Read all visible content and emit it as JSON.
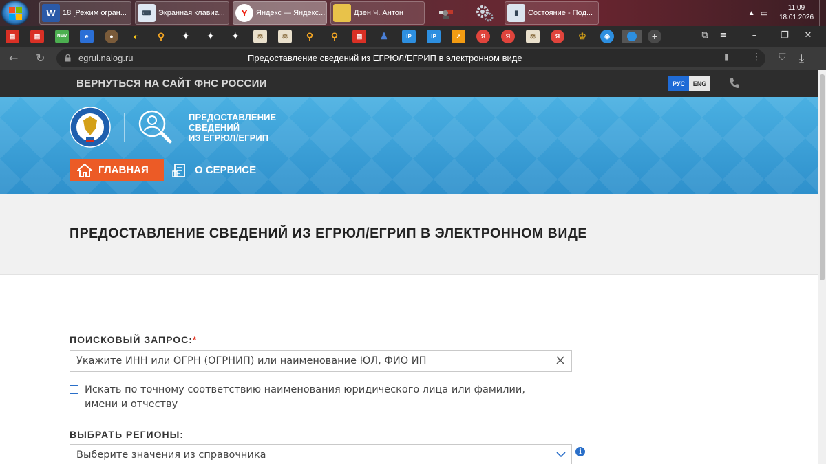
{
  "taskbar": {
    "items": [
      {
        "label": "18 [Режим огран...",
        "icon": "word-icon"
      },
      {
        "label": "Экранная клавиа...",
        "icon": "keyboard-icon"
      },
      {
        "label": "Яндекс — Яндекс...",
        "icon": "yandex-browser-icon"
      },
      {
        "label": "Дзен Ч. Антон",
        "icon": "folder-icon"
      },
      {
        "label": "",
        "icon": "satellite-icon"
      },
      {
        "label": "",
        "icon": "gears-icon"
      },
      {
        "label": "Состояние - Под...",
        "icon": "network-status-icon"
      }
    ],
    "clock_time": "11:09",
    "clock_date": "18.01.2026"
  },
  "browser": {
    "url_host": "egrul.nalog.ru",
    "page_title": "Предоставление сведений из ЕГРЮЛ/ЕГРИП в электронном виде"
  },
  "site": {
    "back_link": "ВЕРНУТЬСЯ НА САЙТ ФНС РОССИИ",
    "lang_rus": "РУС",
    "lang_eng": "ENG",
    "service_title": [
      "ПРЕДОСТАВЛЕНИЕ",
      "СВЕДЕНИЙ",
      "ИЗ ЕГРЮЛ/ЕГРИП"
    ],
    "nav_main": "ГЛАВНАЯ",
    "nav_about": "О СЕРВИСЕ",
    "heading": "ПРЕДОСТАВЛЕНИЕ СВЕДЕНИЙ ИЗ ЕГРЮЛ/ЕГРИП В ЭЛЕКТРОННОМ ВИДЕ"
  },
  "form": {
    "query_label": "ПОИСКОВЫЙ ЗАПРОС:",
    "query_required_mark": "*",
    "query_placeholder": "Укажите ИНН или ОГРН (ОГРНИП) или наименование ЮЛ, ФИО ИП",
    "exact_match_label": "Искать по точному соответствию наименования юридического лица или фамилии, имени и отчеству",
    "exact_match_checked": false,
    "regions_label": "ВЫБРАТЬ РЕГИОНЫ:",
    "regions_placeholder": "Выберите значения из справочника"
  },
  "colors": {
    "accent_orange": "#ec5b26",
    "banner_blue": "#3c9fd4",
    "link_blue": "#2a6fc9",
    "topbar_dark": "#2d2d2d"
  }
}
